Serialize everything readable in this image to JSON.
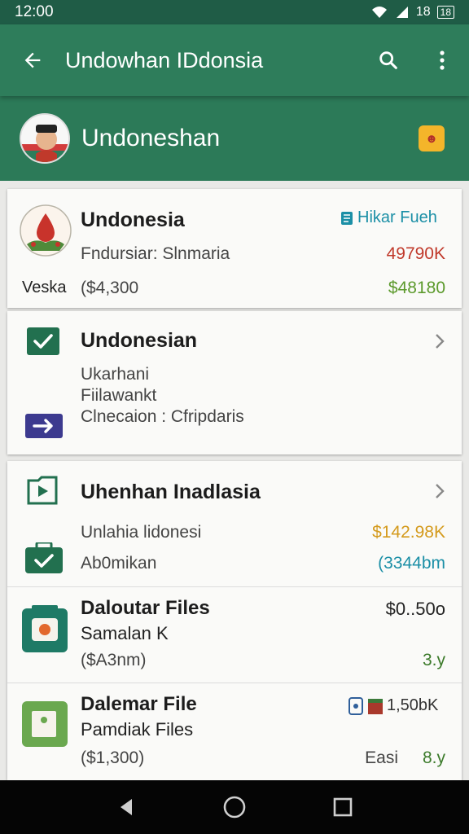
{
  "status": {
    "time": "12:00",
    "icons": [
      "wifi-icon",
      "signal-icon"
    ],
    "network": "18",
    "battery": "18"
  },
  "toolbar": {
    "title": "Undowhan IDdonsia",
    "back_icon": "arrow-back-icon",
    "search_icon": "search-icon",
    "menu_icon": "more-vert-icon"
  },
  "profile": {
    "name": "Undoneshan",
    "badge_text": "☻"
  },
  "cards": {
    "c1": {
      "title": "Undonesia",
      "subtitle": "Fndursiar: Slnmaria",
      "label": "Veska",
      "amount_left": "($4,300",
      "tag": "Hikar Fueh",
      "value_red": "49790K",
      "value_green": "$48180"
    },
    "c2": {
      "title": "Undonesian",
      "line1": "Ukarhani",
      "line2": "Fiilawankt",
      "line3": "Clnecaion : Cfripdaris"
    },
    "c3": {
      "title": "Uhenhan Inadlasia",
      "line1": "Unlahia lidonesi",
      "line1_value": "$142.98K",
      "line2": "Ab0mikan",
      "line2_value": "(3344bm",
      "file1": {
        "title": "Daloutar Files",
        "sub": "Samalan K",
        "meta": "($A3nm)",
        "value": "$0..50o",
        "age": "3.y"
      },
      "file2": {
        "title": "Dalemar File",
        "sub": "Pamdiak Files",
        "meta": "($1,300)",
        "tag": "Easi",
        "value": "1,50bK",
        "age": "8.y"
      }
    }
  },
  "colors": {
    "primary": "#2e7d5b",
    "status": "#1f5c46",
    "accent_red": "#c0392b",
    "accent_green": "#5c9a2c"
  }
}
